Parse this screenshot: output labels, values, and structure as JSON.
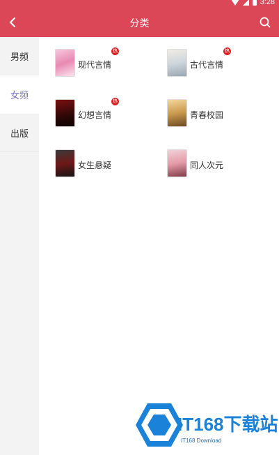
{
  "status_bar": {
    "time": "3:28",
    "icons": [
      "wifi-icon",
      "signal-icon",
      "battery-icon"
    ]
  },
  "app_bar": {
    "title": "分类",
    "back_icon": "chevron-left-icon",
    "search_icon": "search-icon",
    "color": "#db4757"
  },
  "sidebar": {
    "tabs": [
      {
        "label": "男频",
        "active": false
      },
      {
        "label": "女频",
        "active": true
      },
      {
        "label": "出版",
        "active": false
      }
    ],
    "active_color": "#7a74c7"
  },
  "categories": [
    {
      "label": "现代言情",
      "hot": true,
      "badge": "热"
    },
    {
      "label": "古代言情",
      "hot": true,
      "badge": "热"
    },
    {
      "label": "幻想言情",
      "hot": true,
      "badge": "热"
    },
    {
      "label": "青春校园",
      "hot": false
    },
    {
      "label": "女生悬疑",
      "hot": false
    },
    {
      "label": "同人次元",
      "hot": false
    }
  ],
  "watermark": {
    "title": "IT168下载站",
    "subtitle": "IT168 Download"
  }
}
